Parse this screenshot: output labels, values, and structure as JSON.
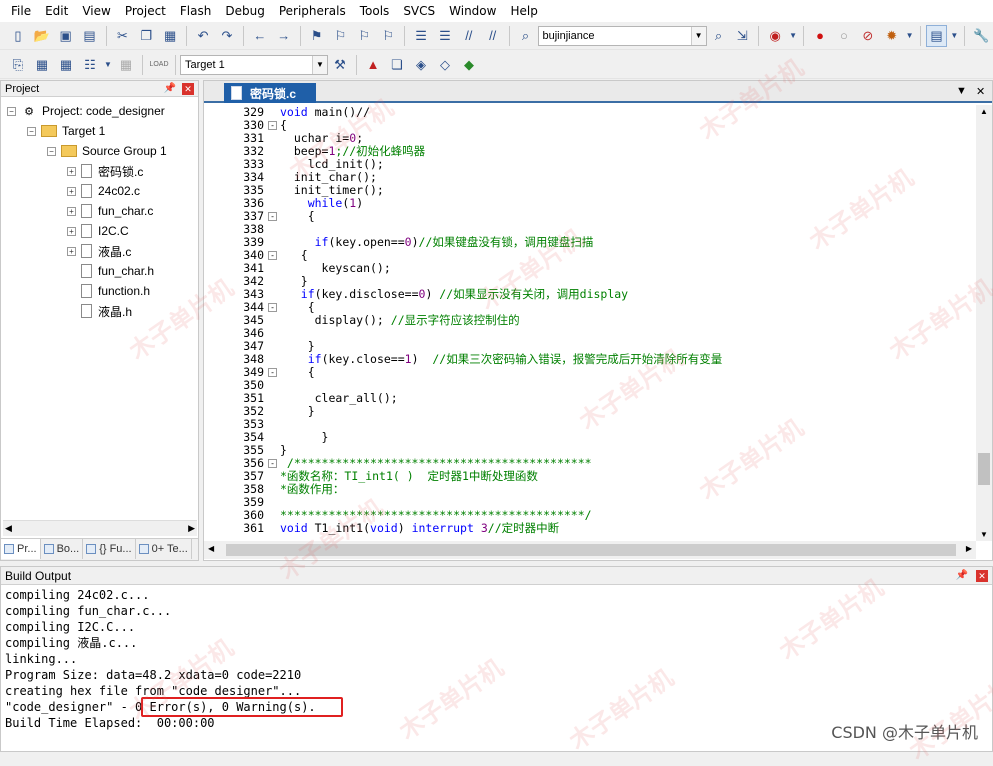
{
  "menu": [
    "File",
    "Edit",
    "View",
    "Project",
    "Flash",
    "Debug",
    "Peripherals",
    "Tools",
    "SVCS",
    "Window",
    "Help"
  ],
  "toolbar1": {
    "target_combo": "bujinjiance"
  },
  "toolbar2": {
    "target_select": "Target 1"
  },
  "project_panel": {
    "title": "Project",
    "tree": [
      {
        "label": "Project: code_designer",
        "level": 0,
        "kind": "project"
      },
      {
        "label": "Target 1",
        "level": 1,
        "kind": "target"
      },
      {
        "label": "Source Group 1",
        "level": 2,
        "kind": "folder"
      },
      {
        "label": "密码锁.c",
        "level": 3,
        "kind": "file",
        "expandable": true
      },
      {
        "label": "24c02.c",
        "level": 3,
        "kind": "file",
        "expandable": true
      },
      {
        "label": "fun_char.c",
        "level": 3,
        "kind": "file",
        "expandable": true
      },
      {
        "label": "I2C.C",
        "level": 3,
        "kind": "file",
        "expandable": true
      },
      {
        "label": "液晶.c",
        "level": 3,
        "kind": "file",
        "expandable": true
      },
      {
        "label": "fun_char.h",
        "level": 3,
        "kind": "file",
        "expandable": false
      },
      {
        "label": "function.h",
        "level": 3,
        "kind": "file",
        "expandable": false
      },
      {
        "label": "液晶.h",
        "level": 3,
        "kind": "file",
        "expandable": false
      }
    ],
    "tabs": [
      "Pr...",
      "Bo...",
      "{} Fu...",
      "0+ Te..."
    ]
  },
  "editor": {
    "tab_label": "密码锁.c",
    "lines": [
      {
        "n": "329",
        "fold": "",
        "segs": [
          [
            "kw",
            "void"
          ],
          [
            "",
            " main()//"
          ]
        ]
      },
      {
        "n": "330",
        "fold": "-",
        "segs": [
          [
            "",
            "{"
          ]
        ]
      },
      {
        "n": "331",
        "fold": "",
        "segs": [
          [
            "",
            "  uchar i="
          ],
          [
            "num",
            "0"
          ],
          [
            "",
            ";"
          ]
        ]
      },
      {
        "n": "332",
        "fold": "",
        "segs": [
          [
            "",
            "  beep="
          ],
          [
            "num",
            "1"
          ],
          [
            "cm",
            ";//初始化蜂鸣器"
          ]
        ]
      },
      {
        "n": "333",
        "fold": "",
        "segs": [
          [
            "",
            "    lcd_init();"
          ]
        ]
      },
      {
        "n": "334",
        "fold": "",
        "segs": [
          [
            "",
            "  init_char();"
          ]
        ]
      },
      {
        "n": "335",
        "fold": "",
        "segs": [
          [
            "",
            "  init_timer();"
          ]
        ]
      },
      {
        "n": "336",
        "fold": "",
        "segs": [
          [
            "",
            "    "
          ],
          [
            "kw",
            "while"
          ],
          [
            "",
            "("
          ],
          [
            "num",
            "1"
          ],
          [
            "",
            ")"
          ]
        ]
      },
      {
        "n": "337",
        "fold": "-",
        "segs": [
          [
            "",
            "    {"
          ]
        ]
      },
      {
        "n": "338",
        "fold": "",
        "segs": [
          [
            "",
            ""
          ]
        ]
      },
      {
        "n": "339",
        "fold": "",
        "segs": [
          [
            "",
            "     "
          ],
          [
            "kw",
            "if"
          ],
          [
            "",
            "(key.open=="
          ],
          [
            "num",
            "0"
          ],
          [
            "",
            ")"
          ],
          [
            "cm",
            "//如果键盘没有锁，调用键盘扫描"
          ]
        ]
      },
      {
        "n": "340",
        "fold": "-",
        "segs": [
          [
            "",
            "   {"
          ]
        ]
      },
      {
        "n": "341",
        "fold": "",
        "segs": [
          [
            "",
            "      keyscan();"
          ]
        ]
      },
      {
        "n": "342",
        "fold": "",
        "segs": [
          [
            "",
            "   }"
          ]
        ]
      },
      {
        "n": "343",
        "fold": "",
        "segs": [
          [
            "",
            "   "
          ],
          [
            "kw",
            "if"
          ],
          [
            "",
            "(key.disclose=="
          ],
          [
            "num",
            "0"
          ],
          [
            "",
            ") "
          ],
          [
            "cm",
            "//如果显示没有关闭，调用display"
          ]
        ]
      },
      {
        "n": "344",
        "fold": "-",
        "segs": [
          [
            "",
            "    {"
          ]
        ]
      },
      {
        "n": "345",
        "fold": "",
        "segs": [
          [
            "",
            "     display(); "
          ],
          [
            "cm",
            "//显示字符应该控制住的"
          ]
        ]
      },
      {
        "n": "346",
        "fold": "",
        "segs": [
          [
            "",
            ""
          ]
        ]
      },
      {
        "n": "347",
        "fold": "",
        "segs": [
          [
            "",
            "    }"
          ]
        ]
      },
      {
        "n": "348",
        "fold": "",
        "segs": [
          [
            "",
            "    "
          ],
          [
            "kw",
            "if"
          ],
          [
            "",
            "(key.close=="
          ],
          [
            "num",
            "1"
          ],
          [
            "",
            ")  "
          ],
          [
            "cm",
            "//如果三次密码输入错误，报警完成后开始清除所有变量"
          ]
        ]
      },
      {
        "n": "349",
        "fold": "-",
        "segs": [
          [
            "",
            "    {"
          ]
        ]
      },
      {
        "n": "350",
        "fold": "",
        "segs": [
          [
            "",
            ""
          ]
        ]
      },
      {
        "n": "351",
        "fold": "",
        "segs": [
          [
            "",
            "     clear_all();"
          ]
        ]
      },
      {
        "n": "352",
        "fold": "",
        "segs": [
          [
            "",
            "    }"
          ]
        ]
      },
      {
        "n": "353",
        "fold": "",
        "segs": [
          [
            "",
            ""
          ]
        ]
      },
      {
        "n": "354",
        "fold": "",
        "segs": [
          [
            "",
            "      }"
          ]
        ]
      },
      {
        "n": "355",
        "fold": "",
        "segs": [
          [
            "",
            "}"
          ]
        ]
      },
      {
        "n": "356",
        "fold": "-",
        "segs": [
          [
            "cm",
            " /*******************************************"
          ]
        ]
      },
      {
        "n": "357",
        "fold": "",
        "segs": [
          [
            "cm",
            "*函数名称：TI_int1( )  定时器1中断处理函数"
          ]
        ]
      },
      {
        "n": "358",
        "fold": "",
        "segs": [
          [
            "cm",
            "*函数作用："
          ]
        ]
      },
      {
        "n": "359",
        "fold": "",
        "segs": [
          [
            "cm",
            ""
          ]
        ]
      },
      {
        "n": "360",
        "fold": "",
        "segs": [
          [
            "cm",
            "********************************************/"
          ]
        ]
      },
      {
        "n": "361",
        "fold": "",
        "segs": [
          [
            "kw",
            "void"
          ],
          [
            "",
            " T1_int1("
          ],
          [
            "kw",
            "void"
          ],
          [
            "",
            ") "
          ],
          [
            "kw",
            "interrupt"
          ],
          [
            "",
            " "
          ],
          [
            "num",
            "3"
          ],
          [
            "cm",
            "//定时器中断"
          ]
        ]
      }
    ]
  },
  "build_output": {
    "title": "Build Output",
    "lines": [
      "compiling 24c02.c...",
      "compiling fun_char.c...",
      "compiling I2C.C...",
      "compiling 液晶.c...",
      "linking...",
      "Program Size: data=48.2 xdata=0 code=2210",
      "creating hex file from \"code designer\"...",
      "\"code_designer\" - 0 Error(s), 0 Warning(s).",
      "Build Time Elapsed:  00:00:00"
    ]
  },
  "watermark": {
    "text": "木子单片机",
    "credit": "CSDN @木子单片机"
  }
}
